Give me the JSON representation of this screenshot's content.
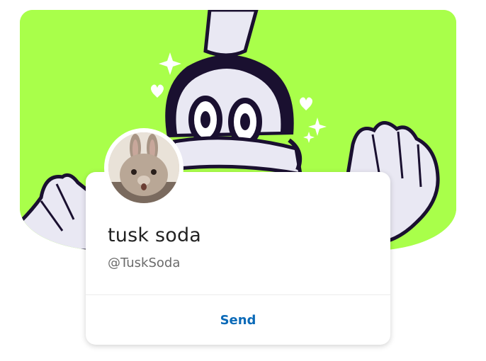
{
  "profile": {
    "display_name": "tusk soda",
    "handle": "@TuskSoda",
    "send_label": "Send"
  },
  "banner": {
    "background_color": "#a9ff4a",
    "outline_color": "#1a1030"
  }
}
